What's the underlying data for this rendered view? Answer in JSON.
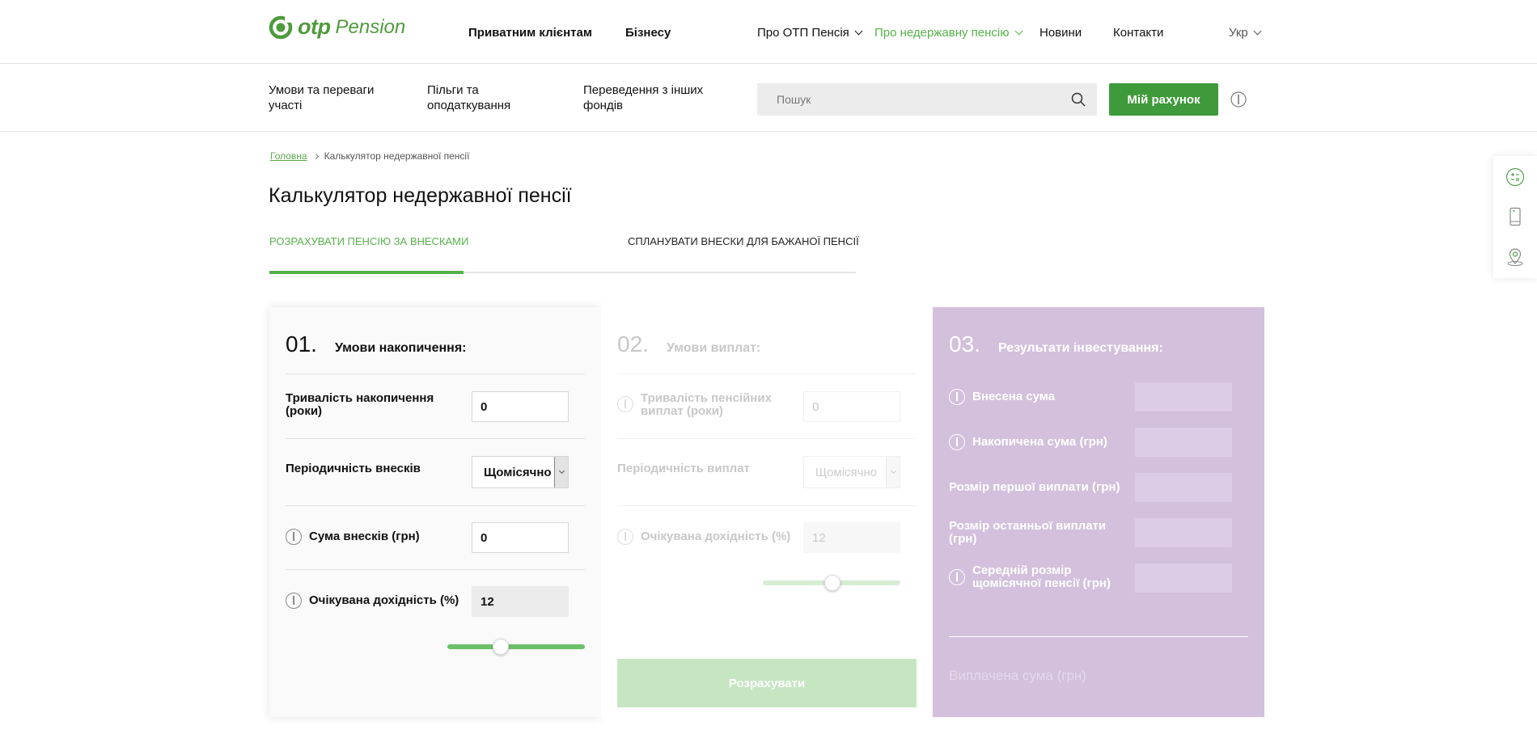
{
  "brand": {
    "logo_text": "otp",
    "logo_sub": "Pension",
    "accent": "#55b24a",
    "accent_dark": "#3e9a3a",
    "results_bg": "#d3c0dc"
  },
  "header": {
    "main_nav": [
      "Приватним клієнтам",
      "Бізнесу"
    ],
    "sec_nav": [
      {
        "label": "Про ОТП Пенсія",
        "dropdown": true
      },
      {
        "label": "Про недержавну пенсію",
        "dropdown": true,
        "active": true
      },
      {
        "label": "Новини"
      },
      {
        "label": "Контакти"
      }
    ],
    "language": "Укр"
  },
  "subnav": {
    "links": [
      {
        "line1": "Умови та переваги",
        "line2": "участі"
      },
      {
        "line1": "Пільги та",
        "line2": "оподаткування"
      },
      {
        "line1": "Переведення з інших",
        "line2": "фондів"
      }
    ],
    "search_placeholder": "Пошук",
    "account_button": "Мій рахунок"
  },
  "breadcrumb": {
    "home": "Головна",
    "current": "Калькулятор недержавної пенсії"
  },
  "page_title": "Калькулятор недержавної пенсії",
  "tabs": [
    {
      "label": "РОЗРАХУВАТИ ПЕНСІЮ ЗА ВНЕСКАМИ",
      "active": true
    },
    {
      "label": "СПЛАНУВАТИ ВНЕСКИ ДЛЯ БАЖАНОЇ ПЕНСІЇ",
      "active": false
    }
  ],
  "step1": {
    "num": "01.",
    "title": "Умови накопичення:",
    "duration_label_1": "Тривалість накопичення",
    "duration_label_2": "(роки)",
    "duration_value": "0",
    "periodicity_label": "Періодичність внесків",
    "periodicity_value": "Щомісячно",
    "amount_label": "Сума внесків (грн)",
    "amount_value": "0",
    "yield_label": "Очікувана дохідність (%)",
    "yield_value": "12",
    "slider_level": 0.3
  },
  "step2": {
    "num": "02.",
    "title": "Умови виплат:",
    "duration_label_1": "Тривалість пенсійних",
    "duration_label_2": "виплат (роки)",
    "duration_value": "0",
    "periodicity_label": "Періодичність виплат",
    "periodicity_value": "Щомісячно",
    "yield_label": "Очікувана дохідність (%)",
    "yield_value": "12",
    "slider_level": 0.3,
    "calc_button": "Розрахувати"
  },
  "step3": {
    "num": "03.",
    "title": "Результати інвестування:",
    "rows": [
      {
        "label_1": "Внесена сума",
        "label_2": "",
        "icon": true
      },
      {
        "label_1": "Накопичена сума (грн)",
        "label_2": "",
        "icon": true
      },
      {
        "label_1": "Розмір першої виплати (грн)",
        "label_2": "",
        "icon": false
      },
      {
        "label_1": "Розмір останньої виплати",
        "label_2": "(грн)",
        "icon": false
      },
      {
        "label_1": "Середній розмір",
        "label_2": "щомісячної пенсії (грн)",
        "icon": true
      }
    ],
    "paid_label": "Виплачена сума (грн)"
  },
  "side_tools": [
    "calculator-icon",
    "phone-icon",
    "map-pin-icon"
  ]
}
